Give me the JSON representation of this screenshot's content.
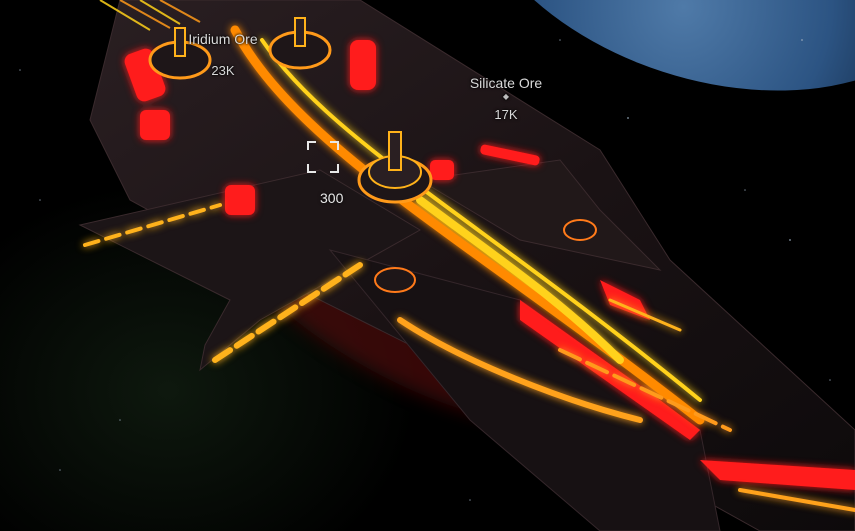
{
  "hud": {
    "ore_labels": [
      {
        "name": "Iridium Ore",
        "value": "23K"
      },
      {
        "name": "Silicate Ore",
        "value": "17K"
      }
    ],
    "target_value": "300"
  },
  "colors": {
    "hull_dark": "#1a1214",
    "neon_red": "#ff1a1a",
    "neon_orange": "#ff7a00",
    "neon_yellow": "#ffd21a",
    "space": "#000000",
    "planet_blue": "#2c5483"
  },
  "icons": {
    "ore_marker": "ore-marker-icon",
    "reticle": "target-reticle-icon"
  }
}
